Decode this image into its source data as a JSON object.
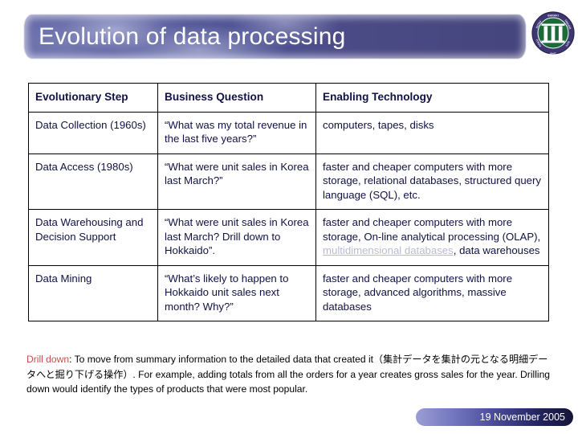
{
  "slide": {
    "title": "Evolution of data processing",
    "logo_icon": "university-seal-icon"
  },
  "table": {
    "headers": [
      "Evolutionary Step",
      "Business Question",
      "Enabling Technology"
    ],
    "rows": [
      {
        "step": "Data Collection (1960s)",
        "question": "“What was my total revenue in the last five years?”",
        "technology": "computers, tapes, disks",
        "technology_link": "",
        "technology_tail": ""
      },
      {
        "step": "Data Access (1980s)",
        "question": "“What were unit sales in Korea last March?”",
        "technology": "faster and cheaper computers with more storage, relational databases, structured query language (SQL), etc.",
        "technology_link": "",
        "technology_tail": ""
      },
      {
        "step": "Data Warehousing and Decision Support",
        "question": "“What were unit sales in Korea last March? Drill down to Hokkaido”.",
        "technology": "faster and cheaper computers with more storage, On-line analytical processing (OLAP), ",
        "technology_link": "multidimensional databases",
        "technology_tail": ", data warehouses"
      },
      {
        "step": "Data Mining",
        "question": "“What’s likely to happen to Hokkaido unit sales next month? Why?”",
        "technology": "faster and cheaper computers with more storage, advanced algorithms, massive databases",
        "technology_link": "",
        "technology_tail": ""
      }
    ]
  },
  "footnote": {
    "term": "Drill down",
    "body": ": To move from summary information to the detailed data that created it（集計データを集計の元となる明細データへと掘り下げる操作）. For example, adding totals from all the orders for a year creates gross sales for the year. Drilling down would identify the types of products that were most popular."
  },
  "footer": {
    "date": "19 November 2005"
  },
  "colors": {
    "banner_start": "#6a6eaa",
    "banner_end": "#46467e",
    "text_navy": "#111144",
    "link_gray": "#b9bad6",
    "term_red": "#c0504d",
    "seal_green": "#1b6b38",
    "seal_purple": "#3d3670"
  }
}
